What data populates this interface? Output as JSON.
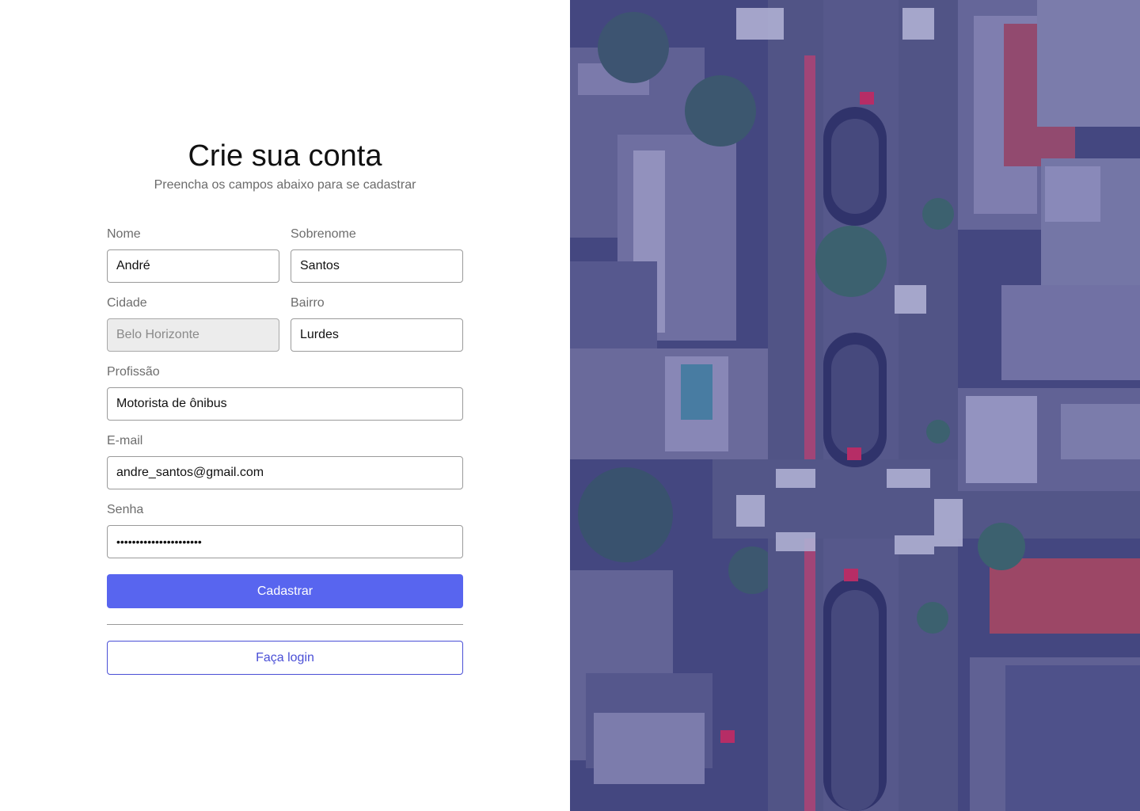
{
  "header": {
    "title": "Crie sua conta",
    "subtitle": "Preencha os campos abaixo para se cadastrar"
  },
  "form": {
    "nome": {
      "label": "Nome",
      "value": "André"
    },
    "sobrenome": {
      "label": "Sobrenome",
      "value": "Santos"
    },
    "cidade": {
      "label": "Cidade",
      "value": "Belo Horizonte",
      "disabled": true
    },
    "bairro": {
      "label": "Bairro",
      "value": "Lurdes"
    },
    "profissao": {
      "label": "Profissão",
      "value": "Motorista de ônibus"
    },
    "email": {
      "label": "E-mail",
      "value": "andre_santos@gmail.com"
    },
    "senha": {
      "label": "Senha",
      "value": "••••••••••••••••••••••"
    }
  },
  "actions": {
    "submit_label": "Cadastrar",
    "login_label": "Faça login"
  },
  "colors": {
    "primary": "#5865ef",
    "outline": "#4a4fd6",
    "image_tint": "#3c3f7a",
    "bike_lane": "#c2416a"
  },
  "image": {
    "description_icon": "aerial-city-photo"
  }
}
